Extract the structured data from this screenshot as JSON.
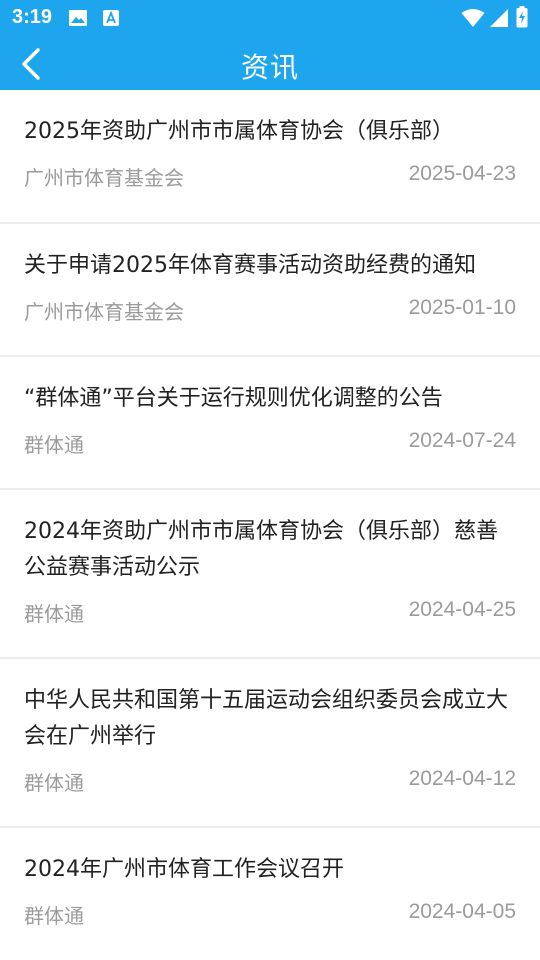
{
  "status_bar": {
    "time": "3:19",
    "icons": [
      "image-icon",
      "accessibility-text-icon",
      "wifi-icon",
      "signal-icon",
      "battery-charging-icon"
    ]
  },
  "app_bar": {
    "title": "资讯",
    "back_icon": "back-chevron-icon"
  },
  "news": [
    {
      "title": "2025年资助广州市市属体育协会（俱乐部）",
      "source": "广州市体育基金会",
      "date": "2025-04-23"
    },
    {
      "title": "关于申请2025年体育赛事活动资助经费的通知",
      "source": "广州市体育基金会",
      "date": "2025-01-10"
    },
    {
      "title": "“群体通”平台关于运行规则优化调整的公告",
      "source": "群体通",
      "date": "2024-07-24"
    },
    {
      "title": "2024年资助广州市市属体育协会（俱乐部）慈善公益赛事活动公示",
      "source": "群体通",
      "date": "2024-04-25"
    },
    {
      "title": "中华人民共和国第十五届运动会组织委员会成立大会在广州举行",
      "source": "群体通",
      "date": "2024-04-12"
    },
    {
      "title": "2024年广州市体育工作会议召开",
      "source": "群体通",
      "date": "2024-04-05"
    }
  ],
  "colors": {
    "accent": "#1da6ee",
    "title_text": "#222222",
    "meta_text": "#9b9b9b",
    "divider": "#ececec"
  }
}
